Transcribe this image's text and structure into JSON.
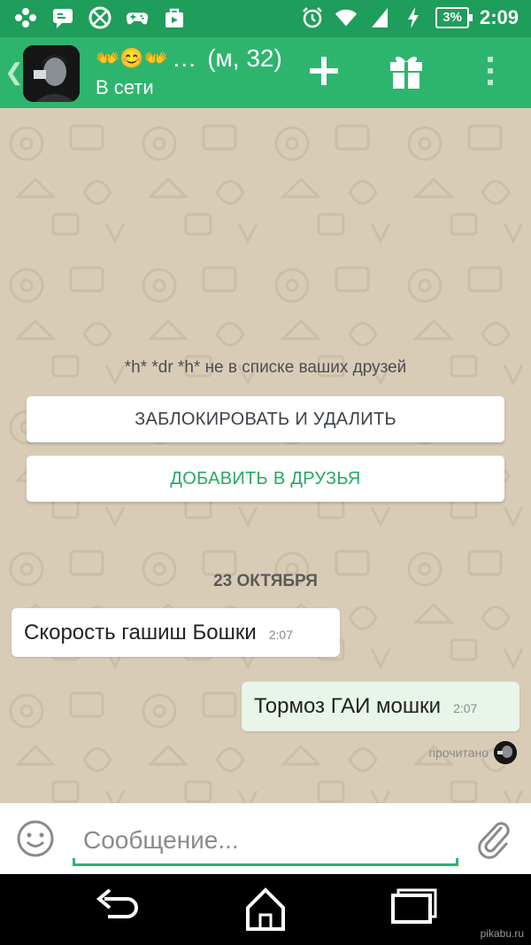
{
  "status_bar": {
    "battery_percent": "3%",
    "time": "2:09",
    "icons": [
      "gamepad-icon",
      "chat-bubble-icon",
      "basketball-icon",
      "game-controller-icon",
      "video-store-icon",
      "alarm-icon",
      "wifi-icon",
      "signal-icon",
      "charging-icon",
      "battery-icon"
    ]
  },
  "header": {
    "back_icon": "chevron-left-icon",
    "name_emoji": "👐😊👐",
    "name_ellipsis": "…",
    "age_sex": "(м, 32)",
    "status": "В сети",
    "actions": [
      "add-icon",
      "gift-icon",
      "more-icon"
    ],
    "accent": "#2db56e",
    "status_bar_color": "#1f9d5a"
  },
  "chat": {
    "notice": "*h* *dr *h* не в списке ваших друзей",
    "block_button": "ЗАБЛОКИРОВАТЬ И УДАЛИТЬ",
    "add_button": "ДОБАВИТЬ В ДРУЗЬЯ",
    "date_separator": "23 ОКТЯБРЯ",
    "messages": [
      {
        "direction": "incoming",
        "text": "Скорость гашиш Бошки",
        "time": "2:07"
      },
      {
        "direction": "outgoing",
        "text": "Тормоз ГАИ мошки",
        "time": "2:07"
      }
    ],
    "read_receipt": "прочитано",
    "background": "#d9ccb6"
  },
  "composer": {
    "placeholder": "Сообщение...",
    "emoji_icon": "smiley-icon",
    "attach_icon": "paperclip-icon"
  },
  "nav_bar": {
    "buttons": [
      "back-icon",
      "home-icon",
      "recents-icon"
    ]
  },
  "watermark": "pikabu.ru"
}
